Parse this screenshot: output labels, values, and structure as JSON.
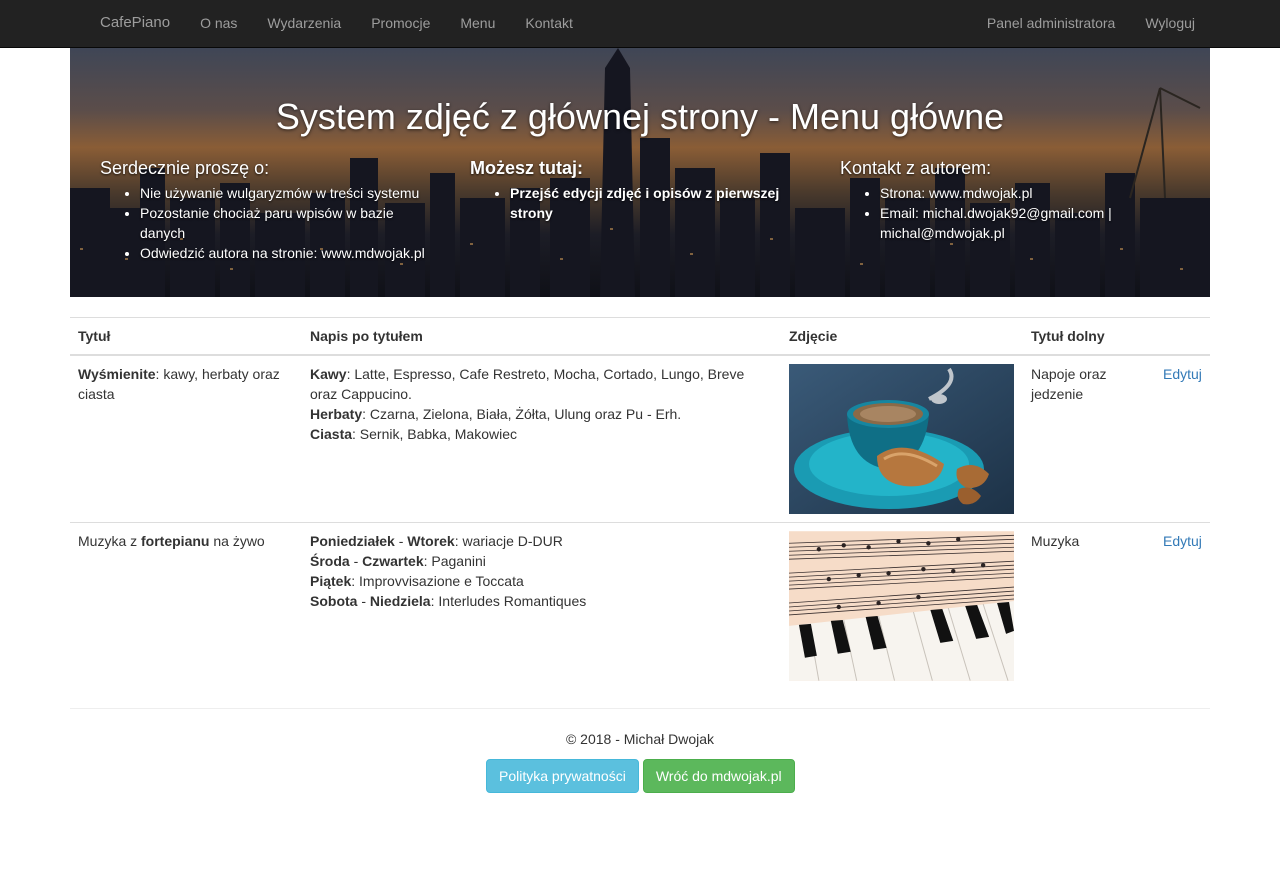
{
  "nav": {
    "brand": "CafePiano",
    "items": [
      "O nas",
      "Wydarzenia",
      "Promocje",
      "Menu",
      "Kontakt"
    ],
    "right": [
      "Panel administratora",
      "Wyloguj"
    ]
  },
  "hero": {
    "title": "System zdjęć z głównej strony - Menu główne",
    "col1": {
      "heading": "Serdecznie proszę o:",
      "items": [
        "Nie używanie wulgaryzmów w treści systemu",
        "Pozostanie chociaż paru wpisów w bazie danych",
        "Odwiedzić autora na stronie: www.mdwojak.pl"
      ]
    },
    "col2": {
      "heading": "Możesz tutaj:",
      "items": [
        "Przejść edycji zdjęć i opisów z pierwszej strony"
      ]
    },
    "col3": {
      "heading": "Kontakt z autorem:",
      "items": [
        "Strona: www.mdwojak.pl",
        "Email: michal.dwojak92@gmail.com | michal@mdwojak.pl"
      ]
    }
  },
  "table": {
    "headers": [
      "Tytuł",
      "Napis po tytułem",
      "Zdjęcie",
      "Tytuł dolny"
    ],
    "rows": [
      {
        "title_bold": "Wyśmienite",
        "title_rest": ": kawy, herbaty oraz ciasta",
        "desc": [
          {
            "label": "Kawy",
            "text": ": Latte, Espresso, Cafe Restreto, Mocha, Cortado, Lungo, Breve oraz Cappucino."
          },
          {
            "label": "Herbaty",
            "text": ": Czarna, Zielona, Biała, Żółta, Ulung oraz Pu - Erh."
          },
          {
            "label": "Ciasta",
            "text": ": Sernik, Babka, Makowiec"
          }
        ],
        "photo": "coffee-cup-photo",
        "bottom_title": "Napoje oraz jedzenie",
        "edit": "Edytuj"
      },
      {
        "title_pre": "Muzyka z ",
        "title_bold": "fortepianu",
        "title_post": " na żywo",
        "desc": [
          {
            "label": "Poniedziałek",
            "mid": " - ",
            "label2": "Wtorek",
            "text": ": wariacje D-DUR"
          },
          {
            "label": "Środa",
            "mid": " - ",
            "label2": "Czwartek",
            "text": ": Paganini"
          },
          {
            "label": "Piątek",
            "text": ": Improvvisazione e Toccata"
          },
          {
            "label": "Sobota",
            "mid": " - ",
            "label2": "Niedziela",
            "text": ": Interludes Romantiques"
          }
        ],
        "photo": "piano-sheet-music-photo",
        "bottom_title": "Muzyka",
        "edit": "Edytuj"
      }
    ]
  },
  "footer": {
    "copyright": "© 2018 - Michał Dwojak",
    "privacy_button": "Polityka prywatności",
    "back_button": "Wróć do mdwojak.pl"
  },
  "colors": {
    "navbar": "#222222",
    "link": "#337ab7",
    "btn_info": "#5bc0de",
    "btn_success": "#5cb85c"
  }
}
